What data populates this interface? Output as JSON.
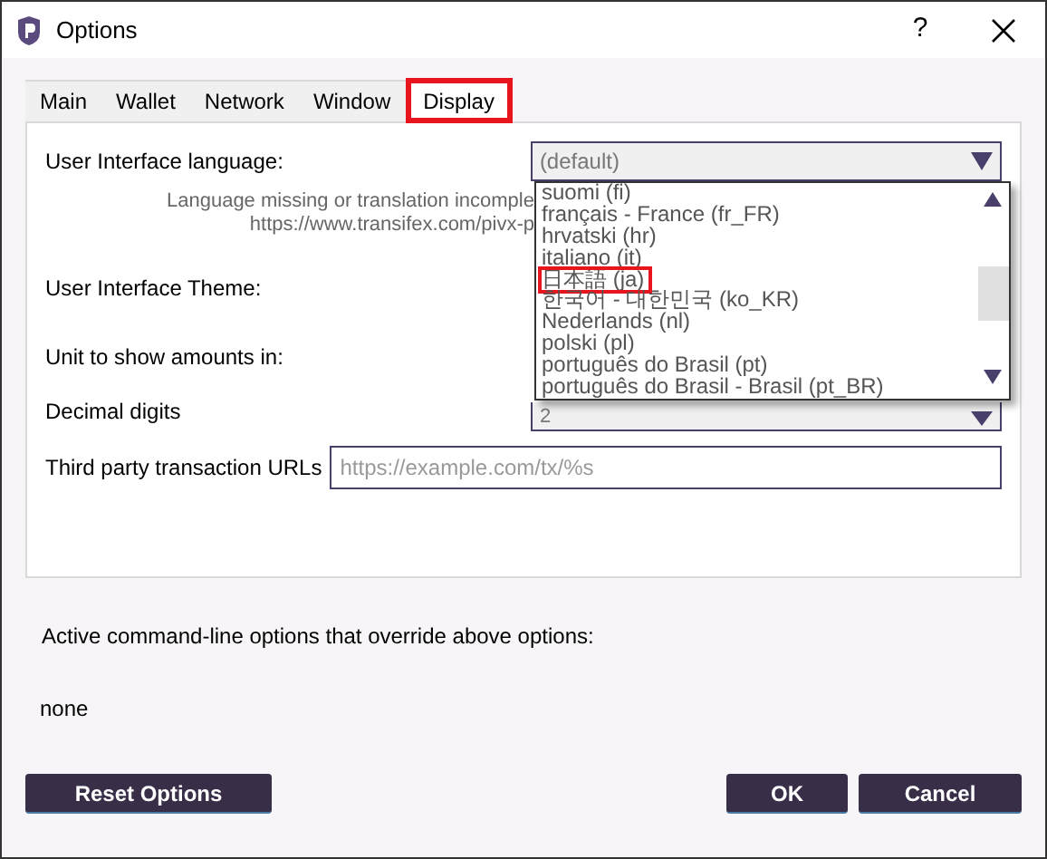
{
  "window": {
    "title": "Options",
    "help": "?"
  },
  "tabs": [
    {
      "label": "Main",
      "selected": false,
      "highlighted": false
    },
    {
      "label": "Wallet",
      "selected": false,
      "highlighted": false
    },
    {
      "label": "Network",
      "selected": false,
      "highlighted": false
    },
    {
      "label": "Window",
      "selected": false,
      "highlighted": false
    },
    {
      "label": "Display",
      "selected": true,
      "highlighted": true
    }
  ],
  "language": {
    "label": "User Interface language:",
    "value": "(default)",
    "note_lines": [
      "Language missing or translation incomple",
      "https://www.transifex.com/pivx-p"
    ],
    "options": [
      {
        "label": "suomi (fi)",
        "highlighted": false
      },
      {
        "label": "français - France (fr_FR)",
        "highlighted": false
      },
      {
        "label": "hrvatski (hr)",
        "highlighted": false
      },
      {
        "label": "italiano (it)",
        "highlighted": false
      },
      {
        "label": "日本語 (ja)",
        "highlighted": true
      },
      {
        "label": "한국어 - 대한민국 (ko_KR)",
        "highlighted": false
      },
      {
        "label": "Nederlands (nl)",
        "highlighted": false
      },
      {
        "label": "polski (pl)",
        "highlighted": false
      },
      {
        "label": "português do Brasil (pt)",
        "highlighted": false
      },
      {
        "label": "português do Brasil - Brasil (pt_BR)",
        "highlighted": false
      }
    ]
  },
  "theme": {
    "label": "User Interface Theme:"
  },
  "unit": {
    "label": "Unit to show amounts in:"
  },
  "decimal_digits": {
    "label": "Decimal digits",
    "value": "2"
  },
  "third_party_urls": {
    "label": "Third party transaction URLs",
    "placeholder": "https://example.com/tx/%s"
  },
  "overrides": {
    "label": "Active command-line options that override above options:",
    "value": "none"
  },
  "buttons": [
    {
      "label": "Reset Options",
      "kind": "left"
    },
    {
      "label": "OK",
      "kind": "right"
    },
    {
      "label": "Cancel",
      "kind": "right"
    }
  ]
}
